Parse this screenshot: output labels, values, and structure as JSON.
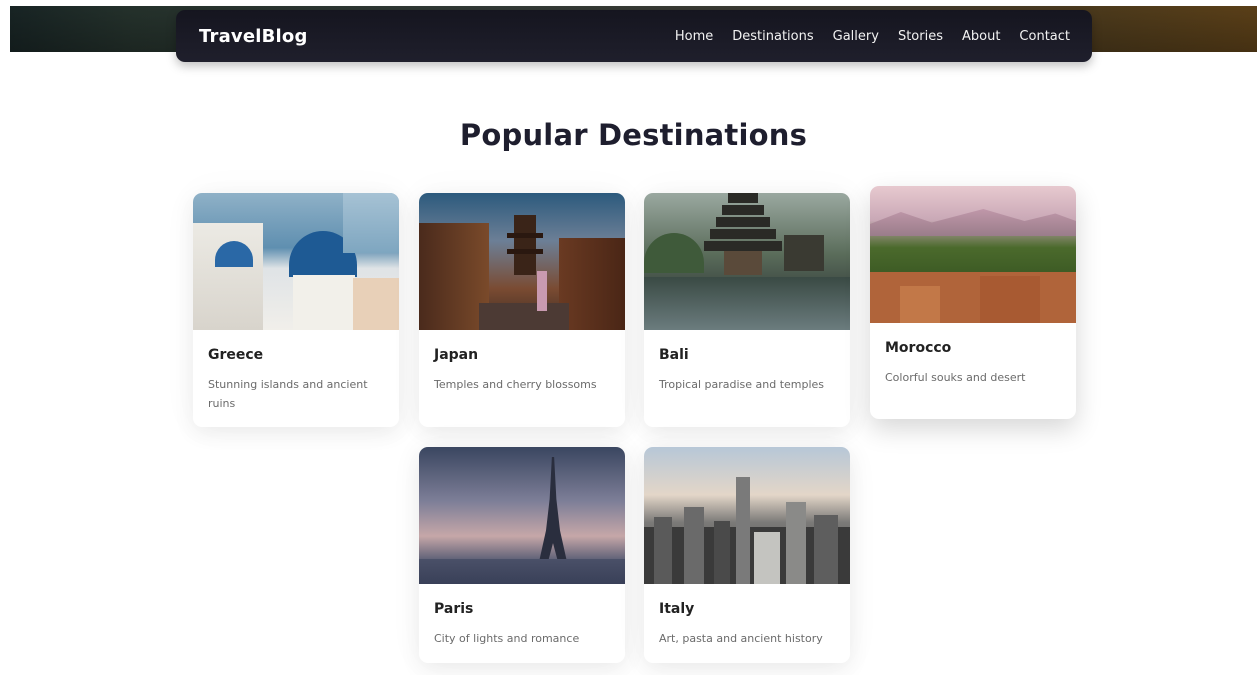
{
  "nav": {
    "brand": "TravelBlog",
    "links": [
      "Home",
      "Destinations",
      "Gallery",
      "Stories",
      "About",
      "Contact"
    ]
  },
  "main": {
    "title": "Popular Destinations",
    "destinations": [
      {
        "name": "Greece",
        "description": "Stunning islands and ancient ruins"
      },
      {
        "name": "Japan",
        "description": "Temples and cherry blossoms"
      },
      {
        "name": "Bali",
        "description": "Tropical paradise and temples"
      },
      {
        "name": "Morocco",
        "description": "Colorful souks and desert"
      },
      {
        "name": "Paris",
        "description": "City of lights and romance"
      },
      {
        "name": "Italy",
        "description": "Art, pasta and ancient history"
      }
    ]
  },
  "colors": {
    "nav_background": "#1a1a26",
    "title": "#1e1e2e",
    "card_text": "#6b6b6b"
  }
}
